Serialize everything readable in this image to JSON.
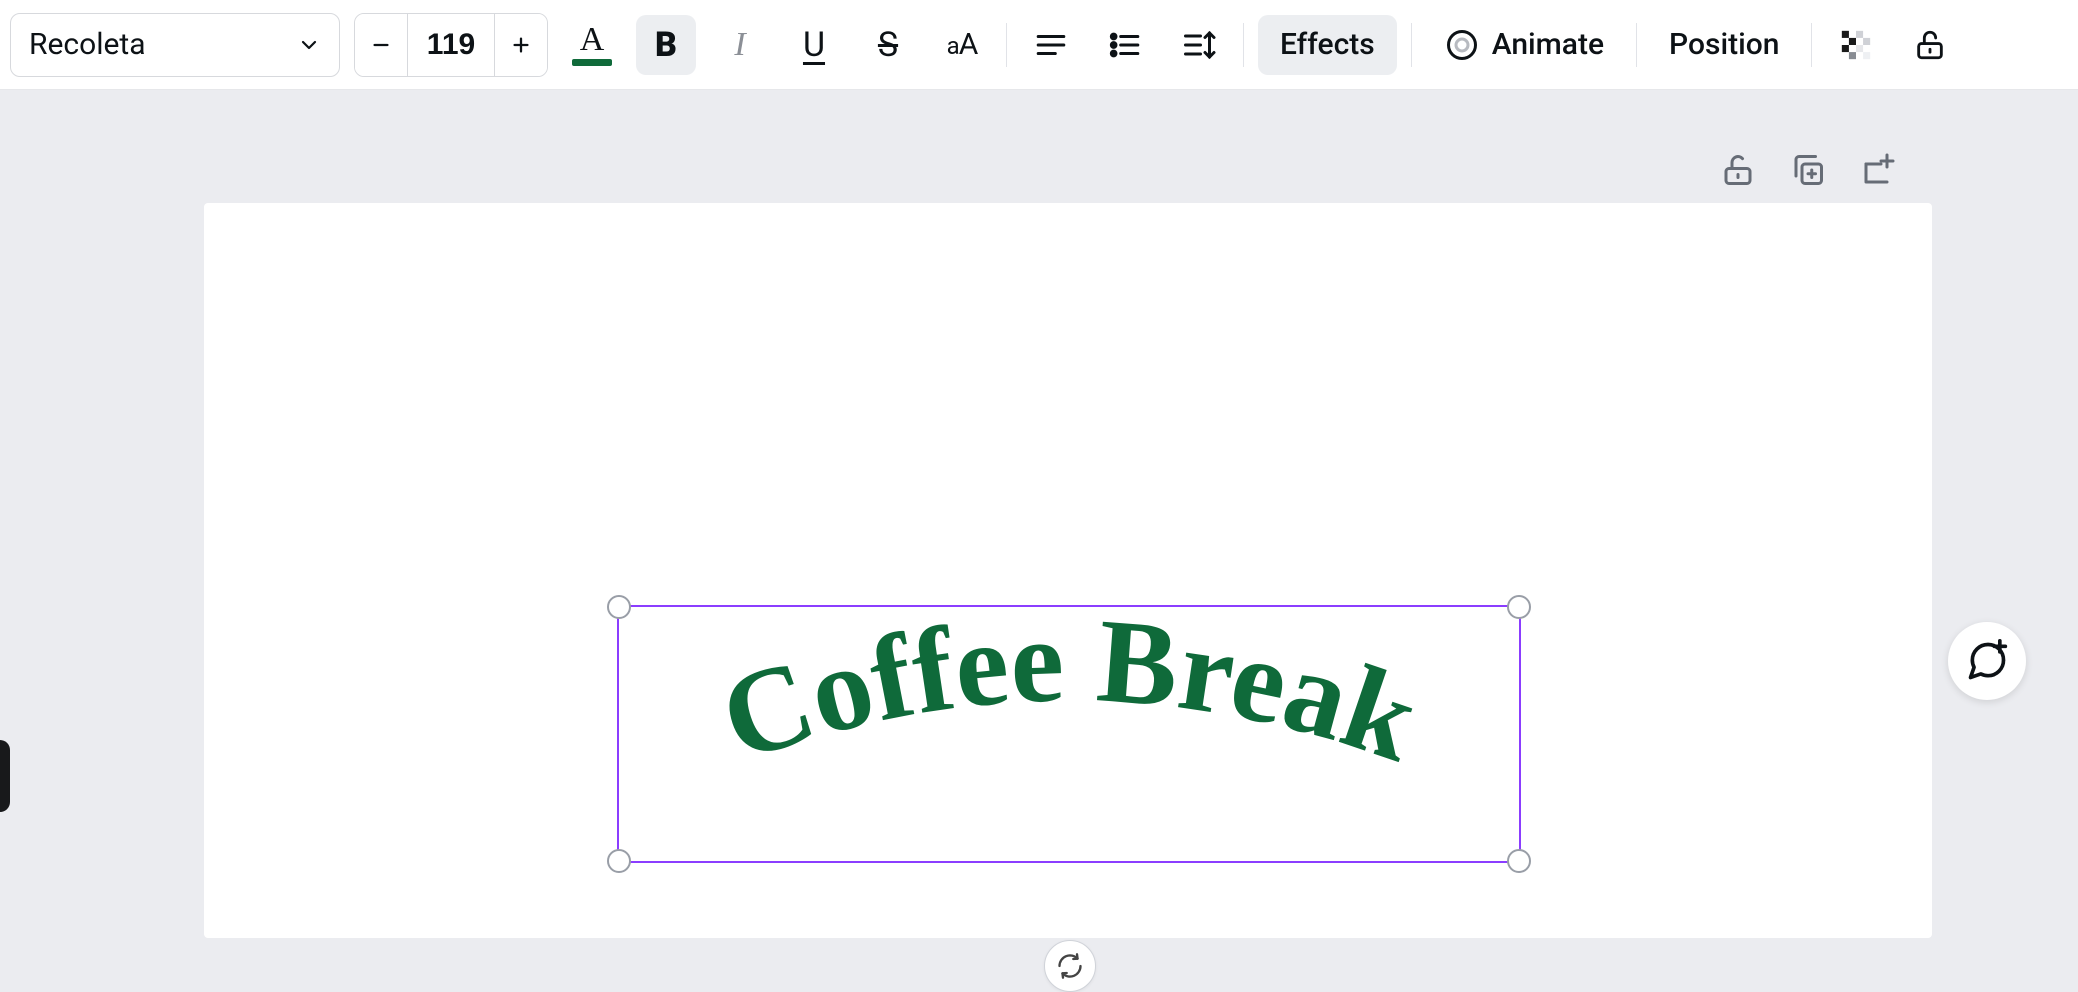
{
  "toolbar": {
    "font_name": "Recoleta",
    "font_size": "119",
    "text_color": "#0f6a3a",
    "effects_label": "Effects",
    "animate_label": "Animate",
    "position_label": "Position",
    "text_color_letter": "A",
    "bold_letter": "B",
    "italic_letter": "I",
    "underline_letter": "U",
    "strike_letter": "S",
    "case_small": "a",
    "case_big": "A"
  },
  "canvas": {
    "selected_text": "Coffee Break",
    "text_color": "#0f6a3a",
    "selection_border": "#8b3dff"
  }
}
